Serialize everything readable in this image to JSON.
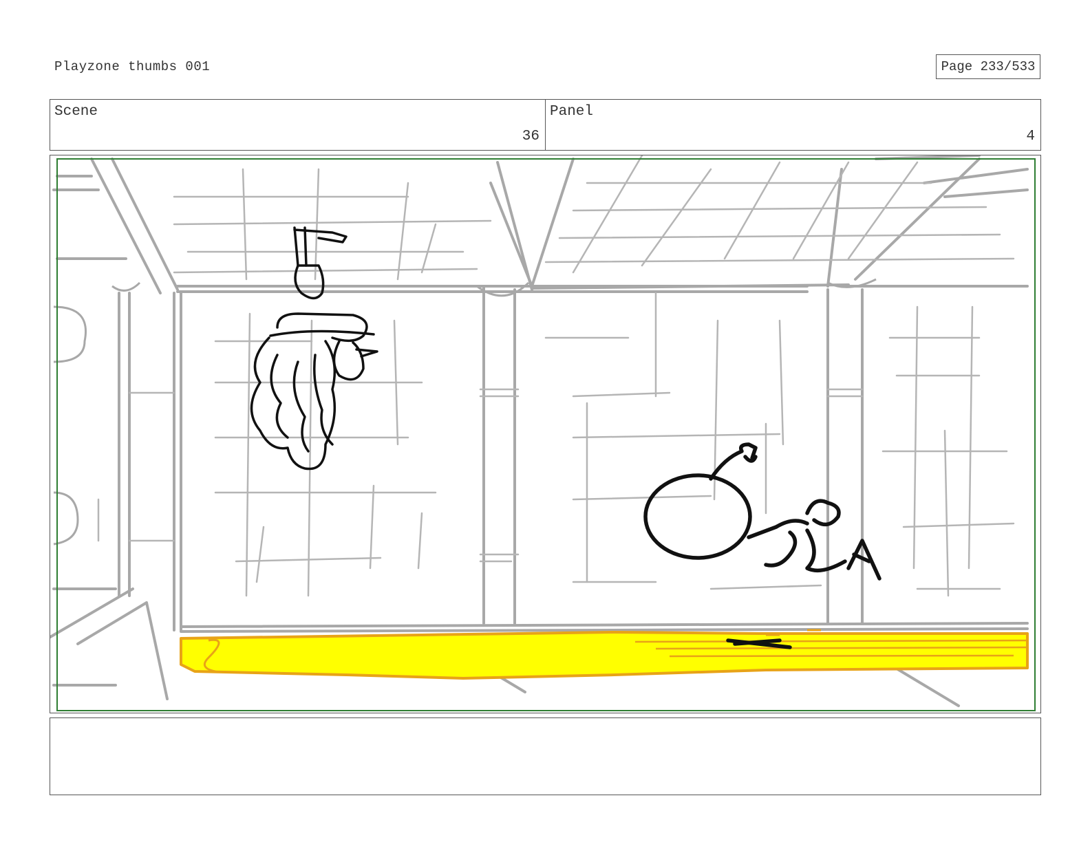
{
  "header": {
    "title": "Playzone thumbs 001",
    "page_indicator": "Page 233/533"
  },
  "info": {
    "scene_label": "Scene",
    "scene_value": "36",
    "panel_label": "Panel",
    "panel_value": "4"
  },
  "notes": {
    "text": ""
  },
  "colors": {
    "safe_frame": "#2e7d32",
    "sketch_gray": "#a8a8a8",
    "ink": "#111111",
    "floor_fill": "#ffff00",
    "floor_outline": "#e8a317"
  }
}
